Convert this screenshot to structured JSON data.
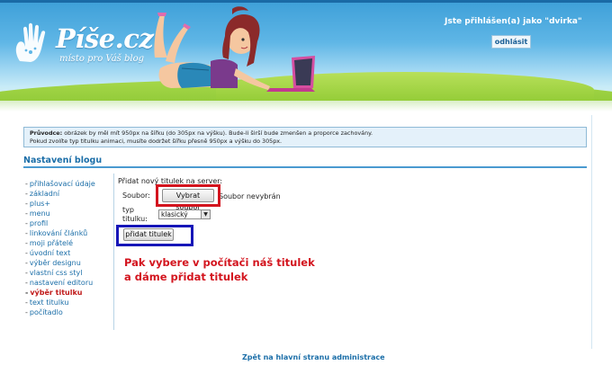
{
  "header": {
    "logo_text": "Píše.cz",
    "logo_subtitle": "místo pro Váš blog",
    "login_status": "Jste přihlášen(a) jako \"dvirka\"",
    "logout_label": "odhlásit"
  },
  "info": {
    "label": "Průvodce:",
    "line1": "obrázek by měl mít 950px na šířku (do 305px na výšku). Bude-li širší bude zmenšen a proporce zachovány.",
    "line2": "Pokud zvolíte typ titulku animaci, musíte dodržet šířku přesně 950px a výšku do 305px."
  },
  "section_title": "Nastavení blogu",
  "sidebar": {
    "items": [
      {
        "label": "přihlašovací údaje",
        "active": false
      },
      {
        "label": "základní",
        "active": false
      },
      {
        "label": "plus+",
        "active": false
      },
      {
        "label": "menu",
        "active": false
      },
      {
        "label": "profil",
        "active": false
      },
      {
        "label": "linkování článků",
        "active": false
      },
      {
        "label": "moji přátelé",
        "active": false
      },
      {
        "label": "úvodní text",
        "active": false
      },
      {
        "label": "výběr designu",
        "active": false
      },
      {
        "label": "vlastní css styl",
        "active": false
      },
      {
        "label": "nastavení editoru",
        "active": false
      },
      {
        "label": "výběr titulku",
        "active": true
      },
      {
        "label": "text titulku",
        "active": false
      },
      {
        "label": "počítadlo",
        "active": false
      }
    ]
  },
  "form": {
    "title": "Přidat nový titulek na server:",
    "file_label": "Soubor:",
    "file_button": "Vybrat soubor",
    "file_status": "Soubor nevybrán",
    "type_label_line1": "typ",
    "type_label_line2": "titulku:",
    "type_selected": "klasický",
    "submit_label": "přidat titulek"
  },
  "annotation": {
    "line1": "Pak vybere v počítači náš titulek",
    "line2": "a dáme přidat titulek"
  },
  "footer": {
    "back_link": "Zpět na hlavní stranu administrace"
  },
  "colors": {
    "accent": "#1b6ea8",
    "highlight_red": "#d3141e",
    "highlight_blue": "#1616b8",
    "active_item": "#c01a1a"
  }
}
